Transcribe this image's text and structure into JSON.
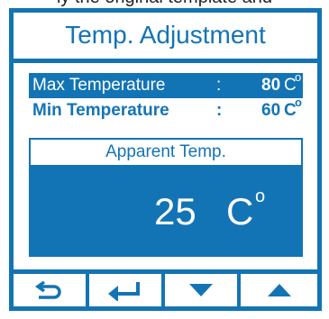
{
  "caption": "ly the original template and",
  "screen": {
    "title": "Temp. Adjustment",
    "rows": [
      {
        "label": "Max Temperature",
        "separator": ":",
        "value": "80",
        "unit": "C",
        "degree": "o",
        "selected": true
      },
      {
        "label": "Min Temperature",
        "separator": ":",
        "value": "60",
        "unit": "C",
        "degree": "o",
        "selected": false
      }
    ],
    "apparent": {
      "heading": "Apparent Temp.",
      "value": "25",
      "unit": "C",
      "degree": "o"
    },
    "buttons": [
      {
        "name": "back-button",
        "icon": "return-arrow-icon"
      },
      {
        "name": "enter-button",
        "icon": "enter-arrow-icon"
      },
      {
        "name": "down-button",
        "icon": "triangle-down-icon"
      },
      {
        "name": "up-button",
        "icon": "triangle-up-icon"
      }
    ]
  },
  "colors": {
    "accent": "#1374b5",
    "background": "#ffffff",
    "text_on_accent": "#ffffff"
  }
}
